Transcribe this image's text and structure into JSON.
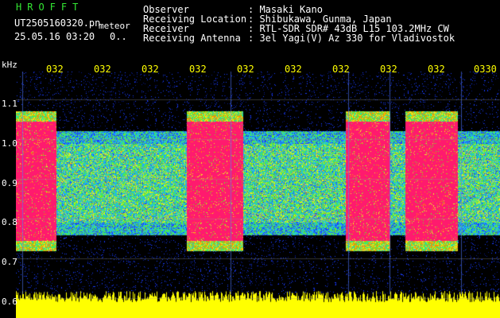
{
  "header": {
    "brand": "HROFFT",
    "filename": "UT2505160320.pn",
    "station": "meteor",
    "date_time": "25.05.16 03:20",
    "dots": "0..",
    "fields": [
      {
        "key": "Observer",
        "value": ": Masaki Kano"
      },
      {
        "key": "Receiving Location",
        "value": ": Shibukawa, Gunma, Japan"
      },
      {
        "key": "Receiver",
        "value": ": RTL-SDR SDR# 43dB L15 103.2MHz CW"
      },
      {
        "key": "Receiving Antenna",
        "value": ": 3el Yagi(V) Az 330 for Vladivostok"
      }
    ]
  },
  "axis": {
    "unit": "kHz",
    "y_labels": [
      "1.1",
      "1.0",
      "0.9",
      "0.8",
      "0.7",
      "0.6"
    ],
    "x_labels": [
      "032",
      "032",
      "032",
      "032",
      "032",
      "032",
      "032",
      "032",
      "032",
      "0330"
    ]
  },
  "colors": {
    "background": "#000000",
    "brand": "#33e633",
    "tick_labels": "#ffff00",
    "signal_hot": "#ff1a6e",
    "noise_band": "#1a3cff",
    "level_trace": "#ffff00"
  }
}
